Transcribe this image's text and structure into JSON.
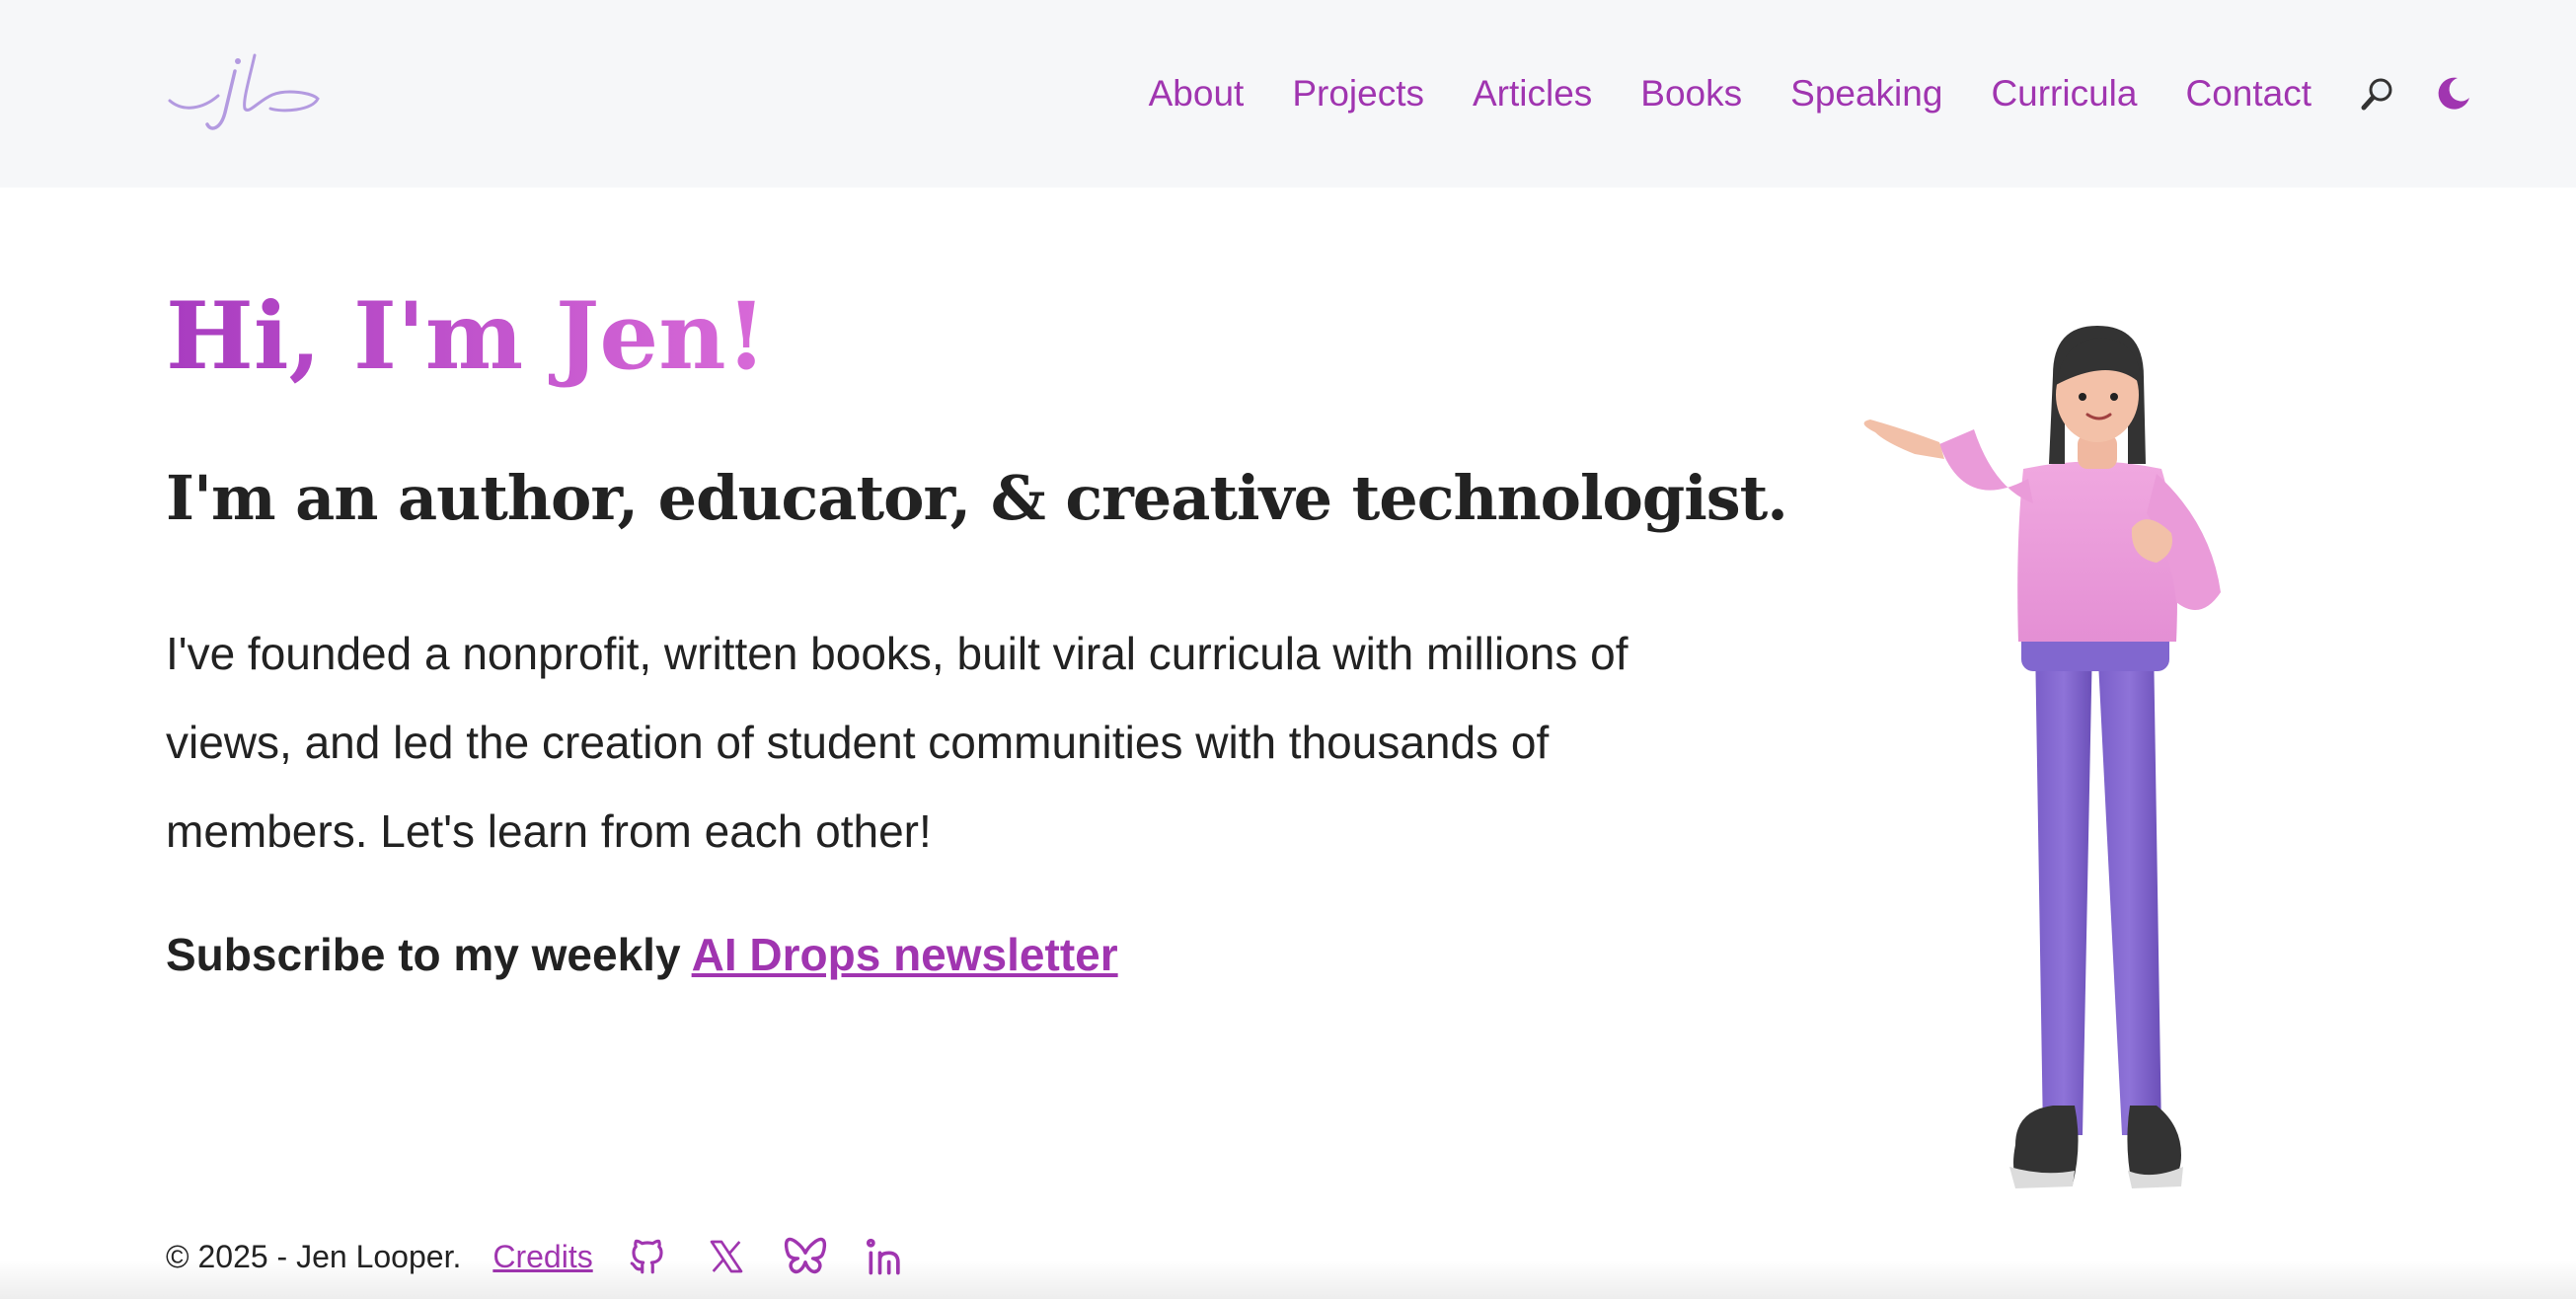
{
  "nav": {
    "items": [
      {
        "label": "About"
      },
      {
        "label": "Projects"
      },
      {
        "label": "Articles"
      },
      {
        "label": "Books"
      },
      {
        "label": "Speaking"
      },
      {
        "label": "Curricula"
      },
      {
        "label": "Contact"
      }
    ],
    "icons": [
      "search-icon",
      "moon-icon"
    ]
  },
  "hero": {
    "title": "Hi, I'm Jen!",
    "subtitle": "I'm an author, educator, & creative technologist.",
    "body": "I've founded a nonprofit, written books, built viral curricula with millions of views, and led the creation of student communities with thousands of members. Let's learn from each other!",
    "subscribe_prefix": "Subscribe to my weekly",
    "subscribe_link": "AI Drops newsletter"
  },
  "footer": {
    "copyright": "© 2025 - Jen Looper.",
    "credits": "Credits",
    "social_icons": [
      "github-icon",
      "x-icon",
      "bluesky-icon",
      "linkedin-icon"
    ]
  },
  "colors": {
    "accent": "#a035b0",
    "header_bg": "#f6f7f9",
    "text": "#222222"
  }
}
